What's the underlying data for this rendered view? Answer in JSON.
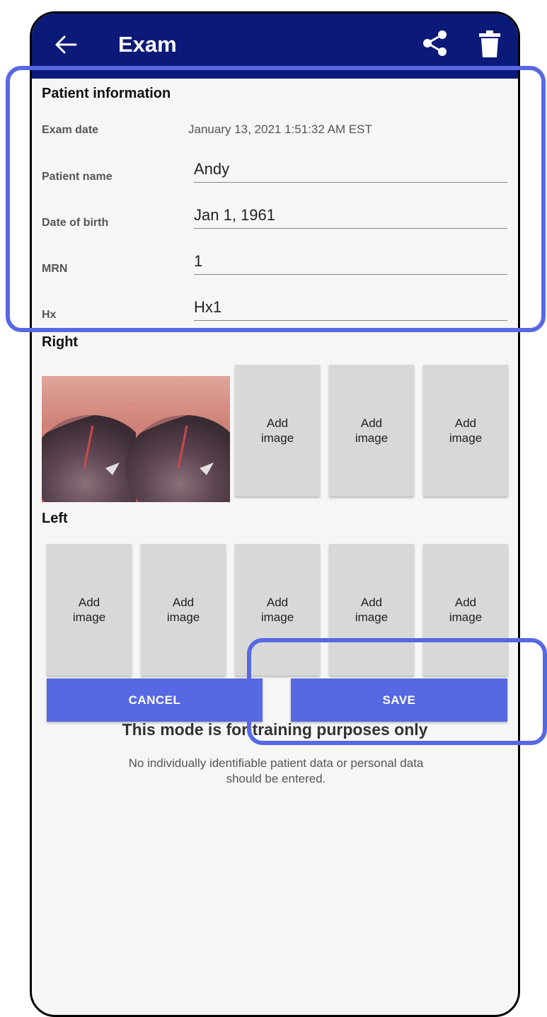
{
  "app_bar": {
    "title": "Exam",
    "back_icon": "arrow-left-icon",
    "share_icon": "share-icon",
    "delete_icon": "trash-icon",
    "background": "#0b1a78"
  },
  "patient_info": {
    "heading": "Patient information",
    "exam_date_label": "Exam date",
    "exam_date_value": "January 13, 2021 1:51:32 AM EST",
    "fields": [
      {
        "label": "Patient name",
        "value": "Andy"
      },
      {
        "label": "Date of birth",
        "value": "Jan 1, 1961"
      },
      {
        "label": "MRN",
        "value": "1"
      },
      {
        "label": "Hx",
        "value": "Hx1"
      }
    ]
  },
  "right": {
    "heading": "Right",
    "add_image_line1": "Add",
    "add_image_line2": "image",
    "empty_slots": 3
  },
  "left": {
    "heading": "Left",
    "add_image_line1": "Add",
    "add_image_line2": "image",
    "empty_slots": 5
  },
  "actions": {
    "cancel_label": "CANCEL",
    "save_label": "SAVE",
    "accent": "#5668e2"
  },
  "notice": {
    "title": "This mode is for training purposes only",
    "body": "No individually identifiable patient data or personal data should be entered."
  }
}
